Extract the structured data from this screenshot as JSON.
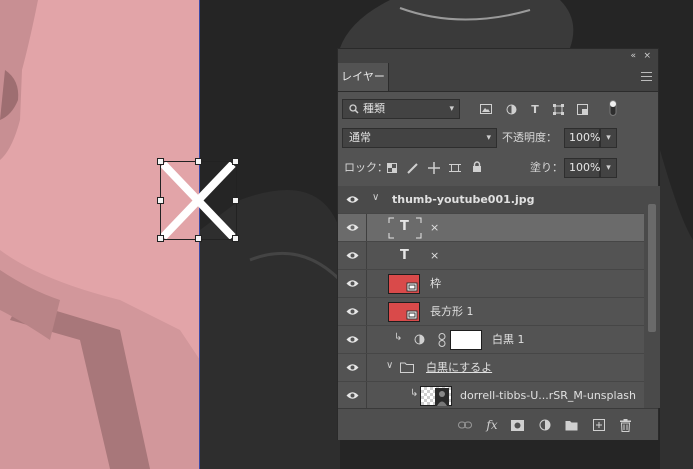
{
  "panel": {
    "tab_label": "レイヤー",
    "top_controls": {
      "collapse": "«",
      "close": "×"
    }
  },
  "filter": {
    "kind_label": "種類",
    "icons": [
      "pixel-filter-icon",
      "adjustment-filter-icon",
      "type-filter-icon",
      "shape-filter-icon",
      "smart-object-filter-icon",
      "filter-toggle-icon"
    ]
  },
  "blend": {
    "mode": "通常",
    "opacity_label": "不透明度：",
    "opacity_value": "100%"
  },
  "lock": {
    "label": "ロック：",
    "fill_label": "塗り：",
    "fill_value": "100%"
  },
  "layers": [
    {
      "name": "thumb-youtube001.jpg",
      "kind": "group-header"
    },
    {
      "name": "×",
      "kind": "text",
      "active": true
    },
    {
      "name": "×",
      "kind": "text"
    },
    {
      "name": "枠",
      "kind": "shape"
    },
    {
      "name": "長方形 1",
      "kind": "shape"
    },
    {
      "name": "白黒 1",
      "kind": "adjustment"
    },
    {
      "name": "白黒にするよ",
      "kind": "folder"
    },
    {
      "name": "dorrell-tibbs-U...rSR_M-unsplash",
      "kind": "smart-object"
    }
  ],
  "footer_tools": [
    "link-icon",
    "fx-icon",
    "mask-icon",
    "adjustment-layer-icon",
    "new-group-icon",
    "new-layer-icon",
    "delete-icon"
  ],
  "colors": {
    "panel_bg": "#535353",
    "canvas_pink": "#e2a4a8",
    "canvas_dark": "#252525",
    "layer_thumb_red": "#d94a4a",
    "active_row": "#6b6b6b"
  }
}
